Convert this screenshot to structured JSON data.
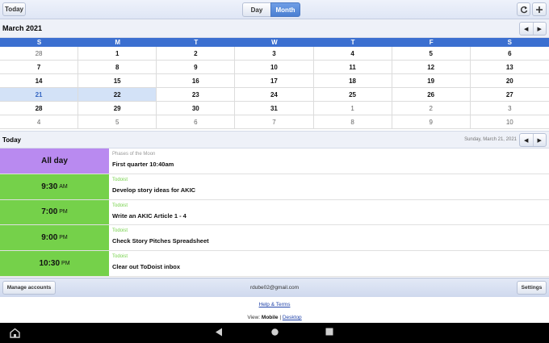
{
  "toolbar": {
    "today_label": "Today",
    "view_day": "Day",
    "view_month": "Month",
    "refresh_icon": "refresh-icon",
    "add_icon": "plus-icon"
  },
  "month_header": {
    "title": "March 2021",
    "prev_icon": "chevron-left-icon",
    "next_icon": "chevron-right-icon"
  },
  "calendar": {
    "weekdays": [
      "S",
      "M",
      "T",
      "W",
      "T",
      "F",
      "S"
    ],
    "weeks": [
      [
        {
          "d": "28",
          "other": true
        },
        {
          "d": "1"
        },
        {
          "d": "2"
        },
        {
          "d": "3"
        },
        {
          "d": "4"
        },
        {
          "d": "5"
        },
        {
          "d": "6"
        }
      ],
      [
        {
          "d": "7"
        },
        {
          "d": "8"
        },
        {
          "d": "9"
        },
        {
          "d": "10"
        },
        {
          "d": "11"
        },
        {
          "d": "12"
        },
        {
          "d": "13"
        }
      ],
      [
        {
          "d": "14"
        },
        {
          "d": "15"
        },
        {
          "d": "16"
        },
        {
          "d": "17"
        },
        {
          "d": "18"
        },
        {
          "d": "19"
        },
        {
          "d": "20"
        }
      ],
      [
        {
          "d": "21",
          "sel": true,
          "today": true
        },
        {
          "d": "22",
          "sel": true
        },
        {
          "d": "23"
        },
        {
          "d": "24"
        },
        {
          "d": "25"
        },
        {
          "d": "26"
        },
        {
          "d": "27"
        }
      ],
      [
        {
          "d": "28"
        },
        {
          "d": "29"
        },
        {
          "d": "30"
        },
        {
          "d": "31"
        },
        {
          "d": "1",
          "other": true
        },
        {
          "d": "2",
          "other": true
        },
        {
          "d": "3",
          "other": true
        }
      ],
      [
        {
          "d": "4",
          "other": true
        },
        {
          "d": "5",
          "other": true
        },
        {
          "d": "6",
          "other": true
        },
        {
          "d": "7",
          "other": true
        },
        {
          "d": "8",
          "other": true
        },
        {
          "d": "9",
          "other": true
        },
        {
          "d": "10",
          "other": true
        }
      ]
    ]
  },
  "today_header": {
    "title": "Today",
    "date": "Sunday, March 21, 2021"
  },
  "events": [
    {
      "time": "All day",
      "ampm": "",
      "source": "Phases of the Moon",
      "title": "First quarter 10:40am",
      "color": "#b98af0",
      "source_color": "#999999"
    },
    {
      "time": "9:30",
      "ampm": "AM",
      "source": "Todoist",
      "title": "Develop story ideas for AKIC",
      "color": "#75d14a",
      "source_color": "#75d14a"
    },
    {
      "time": "7:00",
      "ampm": "PM",
      "source": "Todoist",
      "title": "Write an AKIC Article 1 - 4",
      "color": "#75d14a",
      "source_color": "#75d14a"
    },
    {
      "time": "9:00",
      "ampm": "PM",
      "source": "Todoist",
      "title": "Check Story Pitches Spreadsheet",
      "color": "#75d14a",
      "source_color": "#75d14a"
    },
    {
      "time": "10:30",
      "ampm": "PM",
      "source": "Todoist",
      "title": "Clear out ToDoist inbox",
      "color": "#75d14a",
      "source_color": "#75d14a"
    }
  ],
  "bottom": {
    "manage_label": "Manage accounts",
    "account": "rdube02@gmail.com",
    "settings_label": "Settings"
  },
  "footer": {
    "help": "Help & Terms",
    "view_prefix": "View:",
    "view_mobile": "Mobile",
    "view_sep": "|",
    "view_desktop": "Desktop"
  },
  "android_nav": [
    "home-app-icon",
    "back-icon",
    "home-icon",
    "recents-icon"
  ]
}
